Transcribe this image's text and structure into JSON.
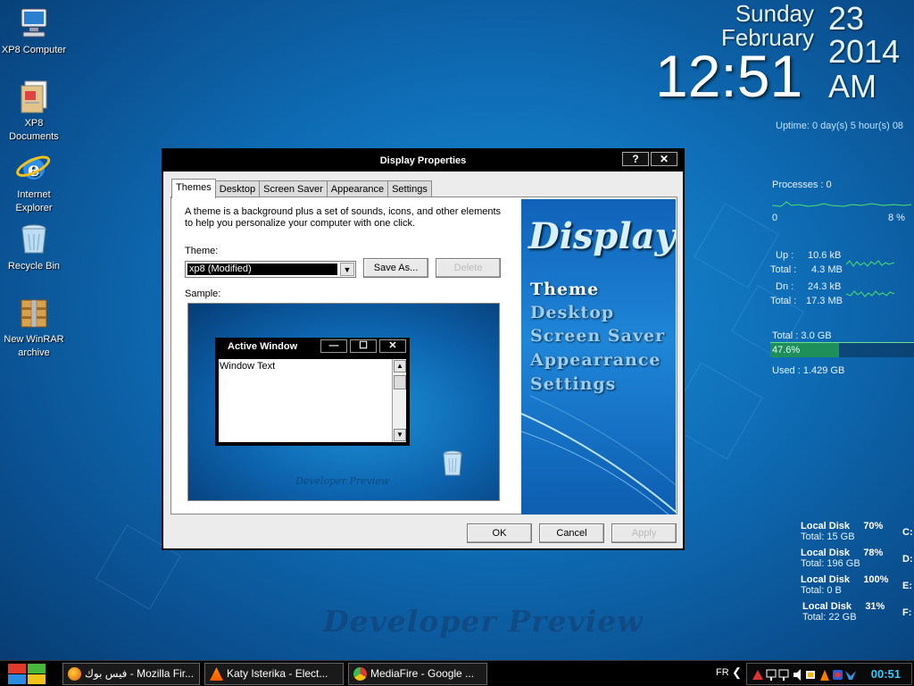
{
  "desktop": {
    "icons": [
      {
        "label": "XP8 Computer"
      },
      {
        "label": "XP8 Documents"
      },
      {
        "label": "Internet Explorer"
      },
      {
        "label": "Recycle Bin"
      },
      {
        "label": "New WinRAR archive"
      }
    ],
    "watermark": "Developer Preview"
  },
  "clock": {
    "day": "Sunday",
    "month": "February",
    "date": "23",
    "year": "2014",
    "time": "12:51",
    "ampm": "AM",
    "uptime": "Uptime: 0 day(s)  5 hour(s)  08"
  },
  "monitor": {
    "processes": "Processes : 0",
    "cpu_min": "0",
    "cpu_max": "8 %",
    "up_label": "Up :",
    "up_value": "10.6 kB",
    "up_total_label": "Total :",
    "up_total": "4.3 MB",
    "dn_label": "Dn :",
    "dn_value": "24.3 kB",
    "dn_total_label": "Total :",
    "dn_total": "17.3 MB",
    "mem_total": "Total : 3.0 GB",
    "mem_percent": "47.6%",
    "mem_used": "Used : 1.429 GB",
    "mem_fraction": 0.476
  },
  "disks": [
    {
      "name": "Local Disk",
      "percent": "70%",
      "total": "Total: 15 GB",
      "letter": "C:"
    },
    {
      "name": "Local Disk",
      "percent": "78%",
      "total": "Total: 196 GB",
      "letter": "D:"
    },
    {
      "name": "Local Disk",
      "percent": "100%",
      "total": "Total: 0 B",
      "letter": "E:"
    },
    {
      "name": "Local Disk",
      "percent": "31%",
      "total": "Total: 22 GB",
      "letter": "F:"
    }
  ],
  "dialog": {
    "title": "Display Properties",
    "help_btn": "?",
    "close_btn": "✕",
    "tabs": [
      "Themes",
      "Desktop",
      "Screen Saver",
      "Appearance",
      "Settings"
    ],
    "description": "A theme is a background plus a set of sounds, icons, and other elements to help you personalize your computer with one click.",
    "theme_label": "Theme:",
    "theme_value": "xp8 (Modified)",
    "save_as": "Save As...",
    "delete": "Delete",
    "sample_label": "Sample:",
    "sample": {
      "window_title": "Active Window",
      "window_text": "Window Text",
      "watermark": "Developer Preview"
    },
    "side": {
      "title": "Display",
      "items": [
        "Theme",
        "Desktop",
        "Screen Saver",
        "Appearrance",
        "Settings"
      ]
    },
    "ok": "OK",
    "cancel": "Cancel",
    "apply": "Apply"
  },
  "taskbar": {
    "tasks": [
      {
        "label": "فيس بوك - Mozilla Fir..."
      },
      {
        "label": "Katy Isterika - Elect..."
      },
      {
        "label": "MediaFire - Google ..."
      }
    ],
    "lang": "FR",
    "tray_arrow": "❮",
    "time": "00:51"
  }
}
